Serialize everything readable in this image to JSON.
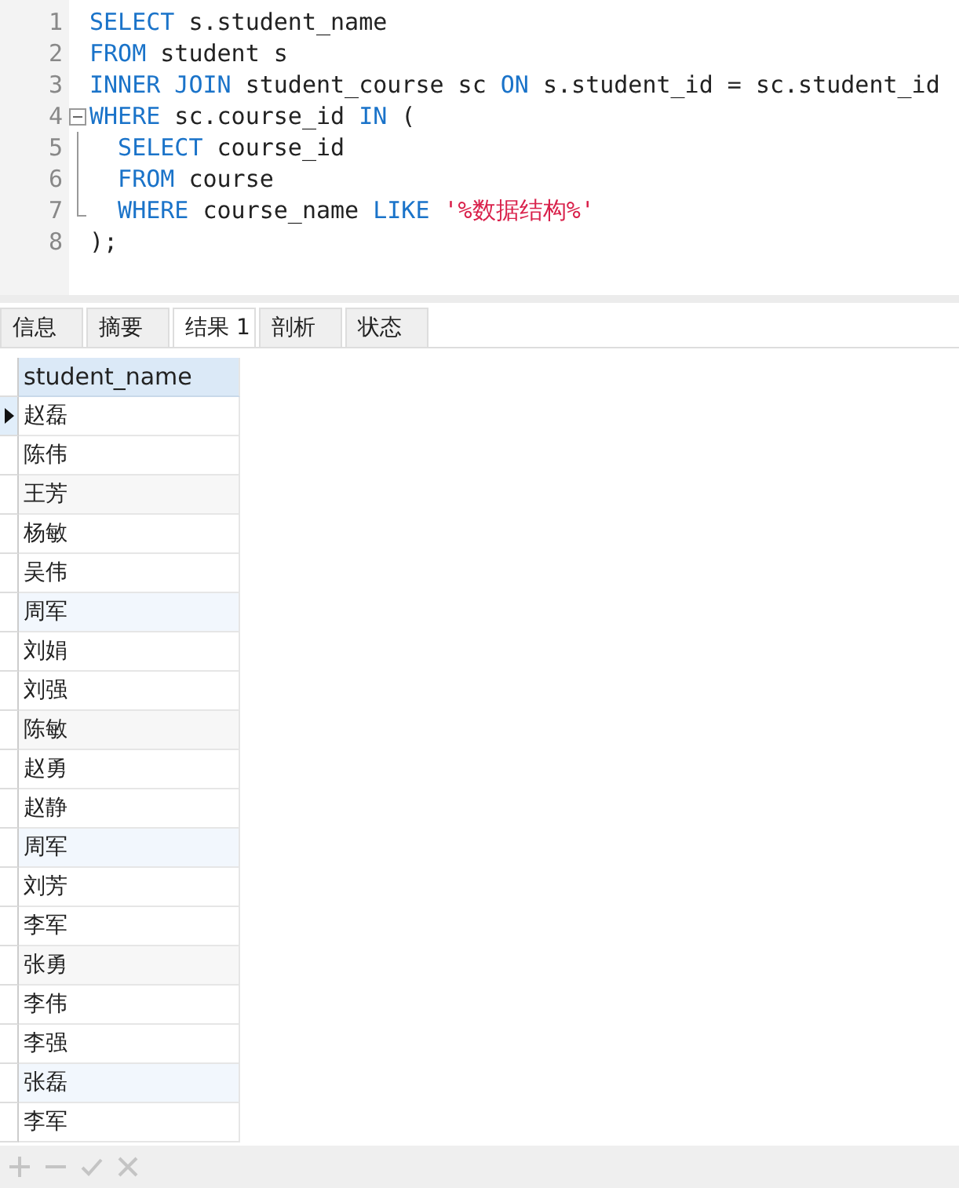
{
  "editor": {
    "lines": [
      {
        "number": "1",
        "kind": "plain",
        "tokens": [
          {
            "kind": "keyword",
            "text": "SELECT"
          },
          {
            "kind": "plain",
            "text": " s.student_name"
          }
        ]
      },
      {
        "number": "2",
        "kind": "plain",
        "tokens": [
          {
            "kind": "keyword",
            "text": "FROM"
          },
          {
            "kind": "plain",
            "text": " student s"
          }
        ]
      },
      {
        "number": "3",
        "kind": "plain",
        "tokens": [
          {
            "kind": "keyword",
            "text": "INNER JOIN"
          },
          {
            "kind": "plain",
            "text": " student_course sc "
          },
          {
            "kind": "keyword",
            "text": "ON"
          },
          {
            "kind": "plain",
            "text": " s.student_id = sc.student_id"
          }
        ]
      },
      {
        "number": "4",
        "kind": "foldstart",
        "tokens": [
          {
            "kind": "keyword",
            "text": "WHERE"
          },
          {
            "kind": "plain",
            "text": " sc.course_id "
          },
          {
            "kind": "keyword",
            "text": "IN"
          },
          {
            "kind": "plain",
            "text": " ("
          }
        ]
      },
      {
        "number": "5",
        "kind": "foldbody",
        "tokens": [
          {
            "kind": "keyword",
            "text": "  SELECT"
          },
          {
            "kind": "plain",
            "text": " course_id"
          }
        ]
      },
      {
        "number": "6",
        "kind": "foldbody",
        "tokens": [
          {
            "kind": "keyword",
            "text": "  FROM"
          },
          {
            "kind": "plain",
            "text": " course"
          }
        ]
      },
      {
        "number": "7",
        "kind": "foldend",
        "tokens": [
          {
            "kind": "keyword",
            "text": "  WHERE"
          },
          {
            "kind": "plain",
            "text": " course_name "
          },
          {
            "kind": "keyword",
            "text": "LIKE"
          },
          {
            "kind": "string",
            "text": " '%数据结构%'"
          }
        ]
      },
      {
        "number": "8",
        "kind": "plain",
        "tokens": [
          {
            "kind": "plain",
            "text": ");"
          }
        ]
      }
    ]
  },
  "tabs": [
    {
      "label": "信息",
      "selected": false
    },
    {
      "label": "摘要",
      "selected": false
    },
    {
      "label": "结果 1",
      "selected": true
    },
    {
      "label": "剖析",
      "selected": false
    },
    {
      "label": "状态",
      "selected": false
    }
  ],
  "table": {
    "columns": [
      "student_name"
    ],
    "rows": [
      {
        "cells": [
          "赵磊"
        ],
        "selected": true
      },
      {
        "cells": [
          "陈伟"
        ],
        "selected": false
      },
      {
        "cells": [
          "王芳"
        ],
        "selected": false
      },
      {
        "cells": [
          "杨敏"
        ],
        "selected": false
      },
      {
        "cells": [
          "吴伟"
        ],
        "selected": false
      },
      {
        "cells": [
          "周军"
        ],
        "selected": false
      },
      {
        "cells": [
          "刘娟"
        ],
        "selected": false
      },
      {
        "cells": [
          "刘强"
        ],
        "selected": false
      },
      {
        "cells": [
          "陈敏"
        ],
        "selected": false
      },
      {
        "cells": [
          "赵勇"
        ],
        "selected": false
      },
      {
        "cells": [
          "赵静"
        ],
        "selected": false
      },
      {
        "cells": [
          "周军"
        ],
        "selected": false
      },
      {
        "cells": [
          "刘芳"
        ],
        "selected": false
      },
      {
        "cells": [
          "李军"
        ],
        "selected": false
      },
      {
        "cells": [
          "张勇"
        ],
        "selected": false
      },
      {
        "cells": [
          "李伟"
        ],
        "selected": false
      },
      {
        "cells": [
          "李强"
        ],
        "selected": false
      },
      {
        "cells": [
          "张磊"
        ],
        "selected": false
      },
      {
        "cells": [
          "李军"
        ],
        "selected": false
      }
    ]
  },
  "toolbar": {
    "buttons": [
      {
        "kind": "add",
        "disabled": true
      },
      {
        "kind": "remove",
        "disabled": true
      },
      {
        "kind": "apply",
        "disabled": true
      },
      {
        "kind": "cancel",
        "disabled": true
      }
    ]
  }
}
